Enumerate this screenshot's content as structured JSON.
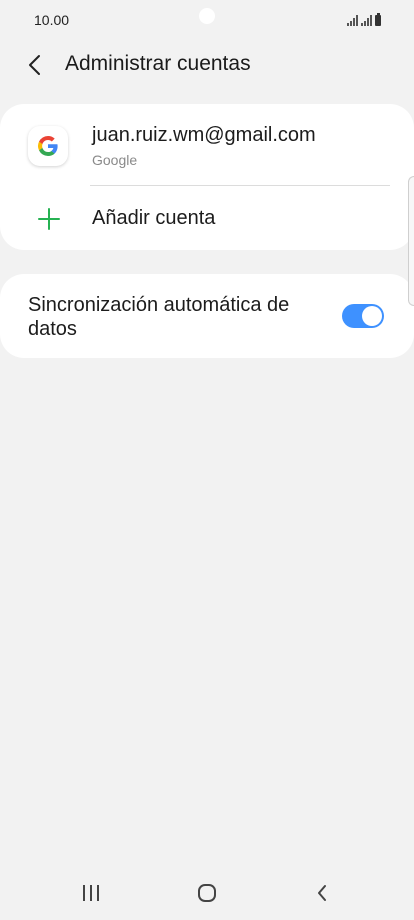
{
  "status_bar": {
    "time": "10.00"
  },
  "header": {
    "title": "Administrar cuentas",
    "back_icon": "chevron-left-icon"
  },
  "accounts": [
    {
      "email": "juan.ruiz.wm@gmail.com",
      "provider": "Google",
      "icon": "google-logo-icon"
    }
  ],
  "add_account": {
    "label": "Añadir cuenta",
    "icon": "plus-icon"
  },
  "sync": {
    "label": "Sincronización automática de datos",
    "enabled": true
  },
  "colors": {
    "background": "#f2f2f2",
    "card": "#ffffff",
    "accent_toggle": "#3e91ff",
    "add_icon": "#26b252",
    "secondary_text": "#8a8a8a"
  },
  "navigation": {
    "recent_icon": "recent-apps-icon",
    "home_icon": "home-icon",
    "back_icon": "back-icon"
  }
}
